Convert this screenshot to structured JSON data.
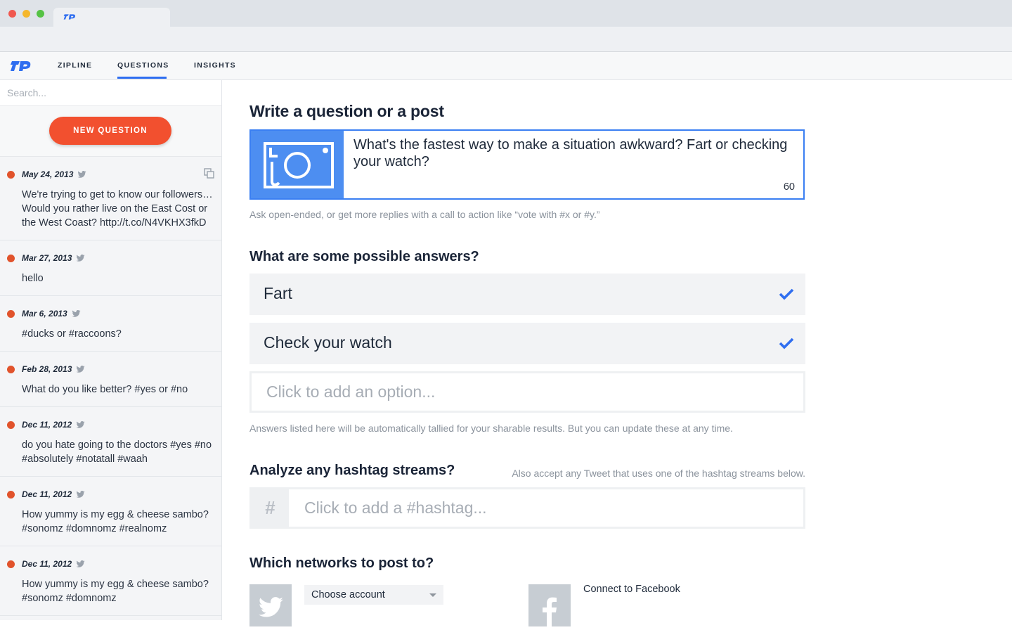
{
  "nav": {
    "zipline": "ZIPLINE",
    "questions": "QUESTIONS",
    "insights": "INSIGHTS",
    "active": "questions"
  },
  "sidebar": {
    "search_placeholder": "Search...",
    "new_question": "NEW QUESTION",
    "questions": [
      {
        "date": "May 24, 2013",
        "text": "We're trying to get to know our followers… Would you rather live on the East Cost or the West Coast? http://t.co/N4VKHX3fkD"
      },
      {
        "date": "Mar 27, 2013",
        "text": "hello"
      },
      {
        "date": "Mar 6, 2013",
        "text": "#ducks or #raccoons?"
      },
      {
        "date": "Feb 28, 2013",
        "text": "What do you like better? #yes or #no"
      },
      {
        "date": "Dec 11, 2012",
        "text": "do you hate going to the doctors #yes #no #absolutely #notatall #waah"
      },
      {
        "date": "Dec 11, 2012",
        "text": "How yummy is my egg & cheese sambo? #sonomz #domnomz #realnomz"
      },
      {
        "date": "Dec 11, 2012",
        "text": "How yummy is my egg & cheese sambo? #sonomz #domnomz"
      }
    ]
  },
  "compose": {
    "heading": "Write a question or a post",
    "post_text": "What's the fastest way to make a situation awkward? Fart or checking your watch?",
    "char_count": "60",
    "hint": "Ask open-ended, or get more replies with a call to action like “vote with #x or #y.”"
  },
  "answers": {
    "heading": "What are some possible answers?",
    "options": [
      "Fart",
      "Check your watch"
    ],
    "add_placeholder": "Click to add an option...",
    "hint": "Answers listed here will be automatically tallied for your sharable results. But you can update these at any time."
  },
  "hashtags": {
    "heading": "Analyze any hashtag streams?",
    "hint": "Also accept any Tweet that uses one of the hashtag streams below.",
    "symbol": "#",
    "placeholder": "Click to add a #hashtag..."
  },
  "networks": {
    "heading": "Which networks to post to?",
    "choose_account": "Choose account",
    "facebook_connect": "Connect to Facebook"
  },
  "colors": {
    "accent_blue": "#2f6ef0",
    "new_question_orange": "#f2502f",
    "status_dot": "#e1532c",
    "photo_tile": "#4d8ef1"
  }
}
